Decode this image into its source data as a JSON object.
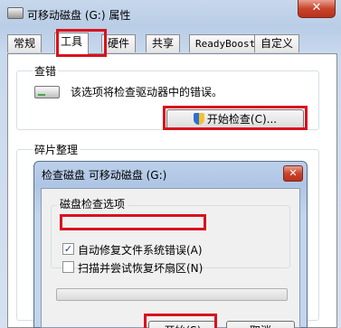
{
  "window": {
    "title": "可移动磁盘 (G:) 属性",
    "close_glyph": "✕"
  },
  "tabs": [
    {
      "label": "常规"
    },
    {
      "label": "工具"
    },
    {
      "label": "硬件"
    },
    {
      "label": "共享"
    },
    {
      "label": "ReadyBoost"
    },
    {
      "label": "自定义"
    }
  ],
  "active_tab": "工具",
  "error_checking": {
    "heading": "查错",
    "description": "该选项将检查驱动器中的错误。",
    "button_label": "开始检查(C)..."
  },
  "defrag": {
    "heading": "碎片整理"
  },
  "check_disk_dialog": {
    "title": "检查磁盘 可移动磁盘 (G:)",
    "close_glyph": "✕",
    "options_heading": "磁盘检查选项",
    "options": [
      {
        "label": "自动修复文件系统错误(A)",
        "checked": true
      },
      {
        "label": "扫描并尝试恢复坏扇区(N)",
        "checked": false
      }
    ],
    "progress": 0,
    "start_label": "开始(S)",
    "cancel_label": "取消"
  },
  "colors": {
    "highlight": "#d9121e",
    "progress_fill": "#4fbf46"
  }
}
